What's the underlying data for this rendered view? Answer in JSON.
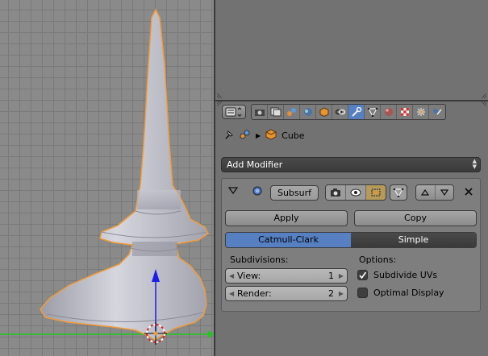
{
  "breadcrumb": {
    "object_name": "Cube"
  },
  "add_modifier": {
    "label": "Add Modifier"
  },
  "modifier": {
    "name": "Subsurf",
    "apply_label": "Apply",
    "copy_label": "Copy",
    "mode_catmull": "Catmull-Clark",
    "mode_simple": "Simple",
    "subdivisions_label": "Subdivisions:",
    "view_label": "View:",
    "view_value": "1",
    "render_label": "Render:",
    "render_value": "2",
    "options_label": "Options:",
    "subdivide_uvs_label": "Subdivide UVs",
    "subdivide_uvs_checked": true,
    "optimal_display_label": "Optimal Display",
    "optimal_display_checked": false,
    "selected_mode": "Catmull-Clark"
  },
  "property_tabs": [
    "render-icon",
    "render-layers-icon",
    "scene-icon",
    "world-icon",
    "object-icon",
    "constraints-icon",
    "modifiers-icon",
    "data-icon",
    "material-icon",
    "texture-icon",
    "particles-icon",
    "physics-icon"
  ],
  "active_tab": "modifiers-icon",
  "colors": {
    "accent": "#5680c2",
    "panel_bg": "#727272",
    "viewport_bg": "#8a8a8a",
    "object_outline": "#f29b38",
    "axis_green": "#1ec81e",
    "axis_blue": "#1e1ee6"
  }
}
